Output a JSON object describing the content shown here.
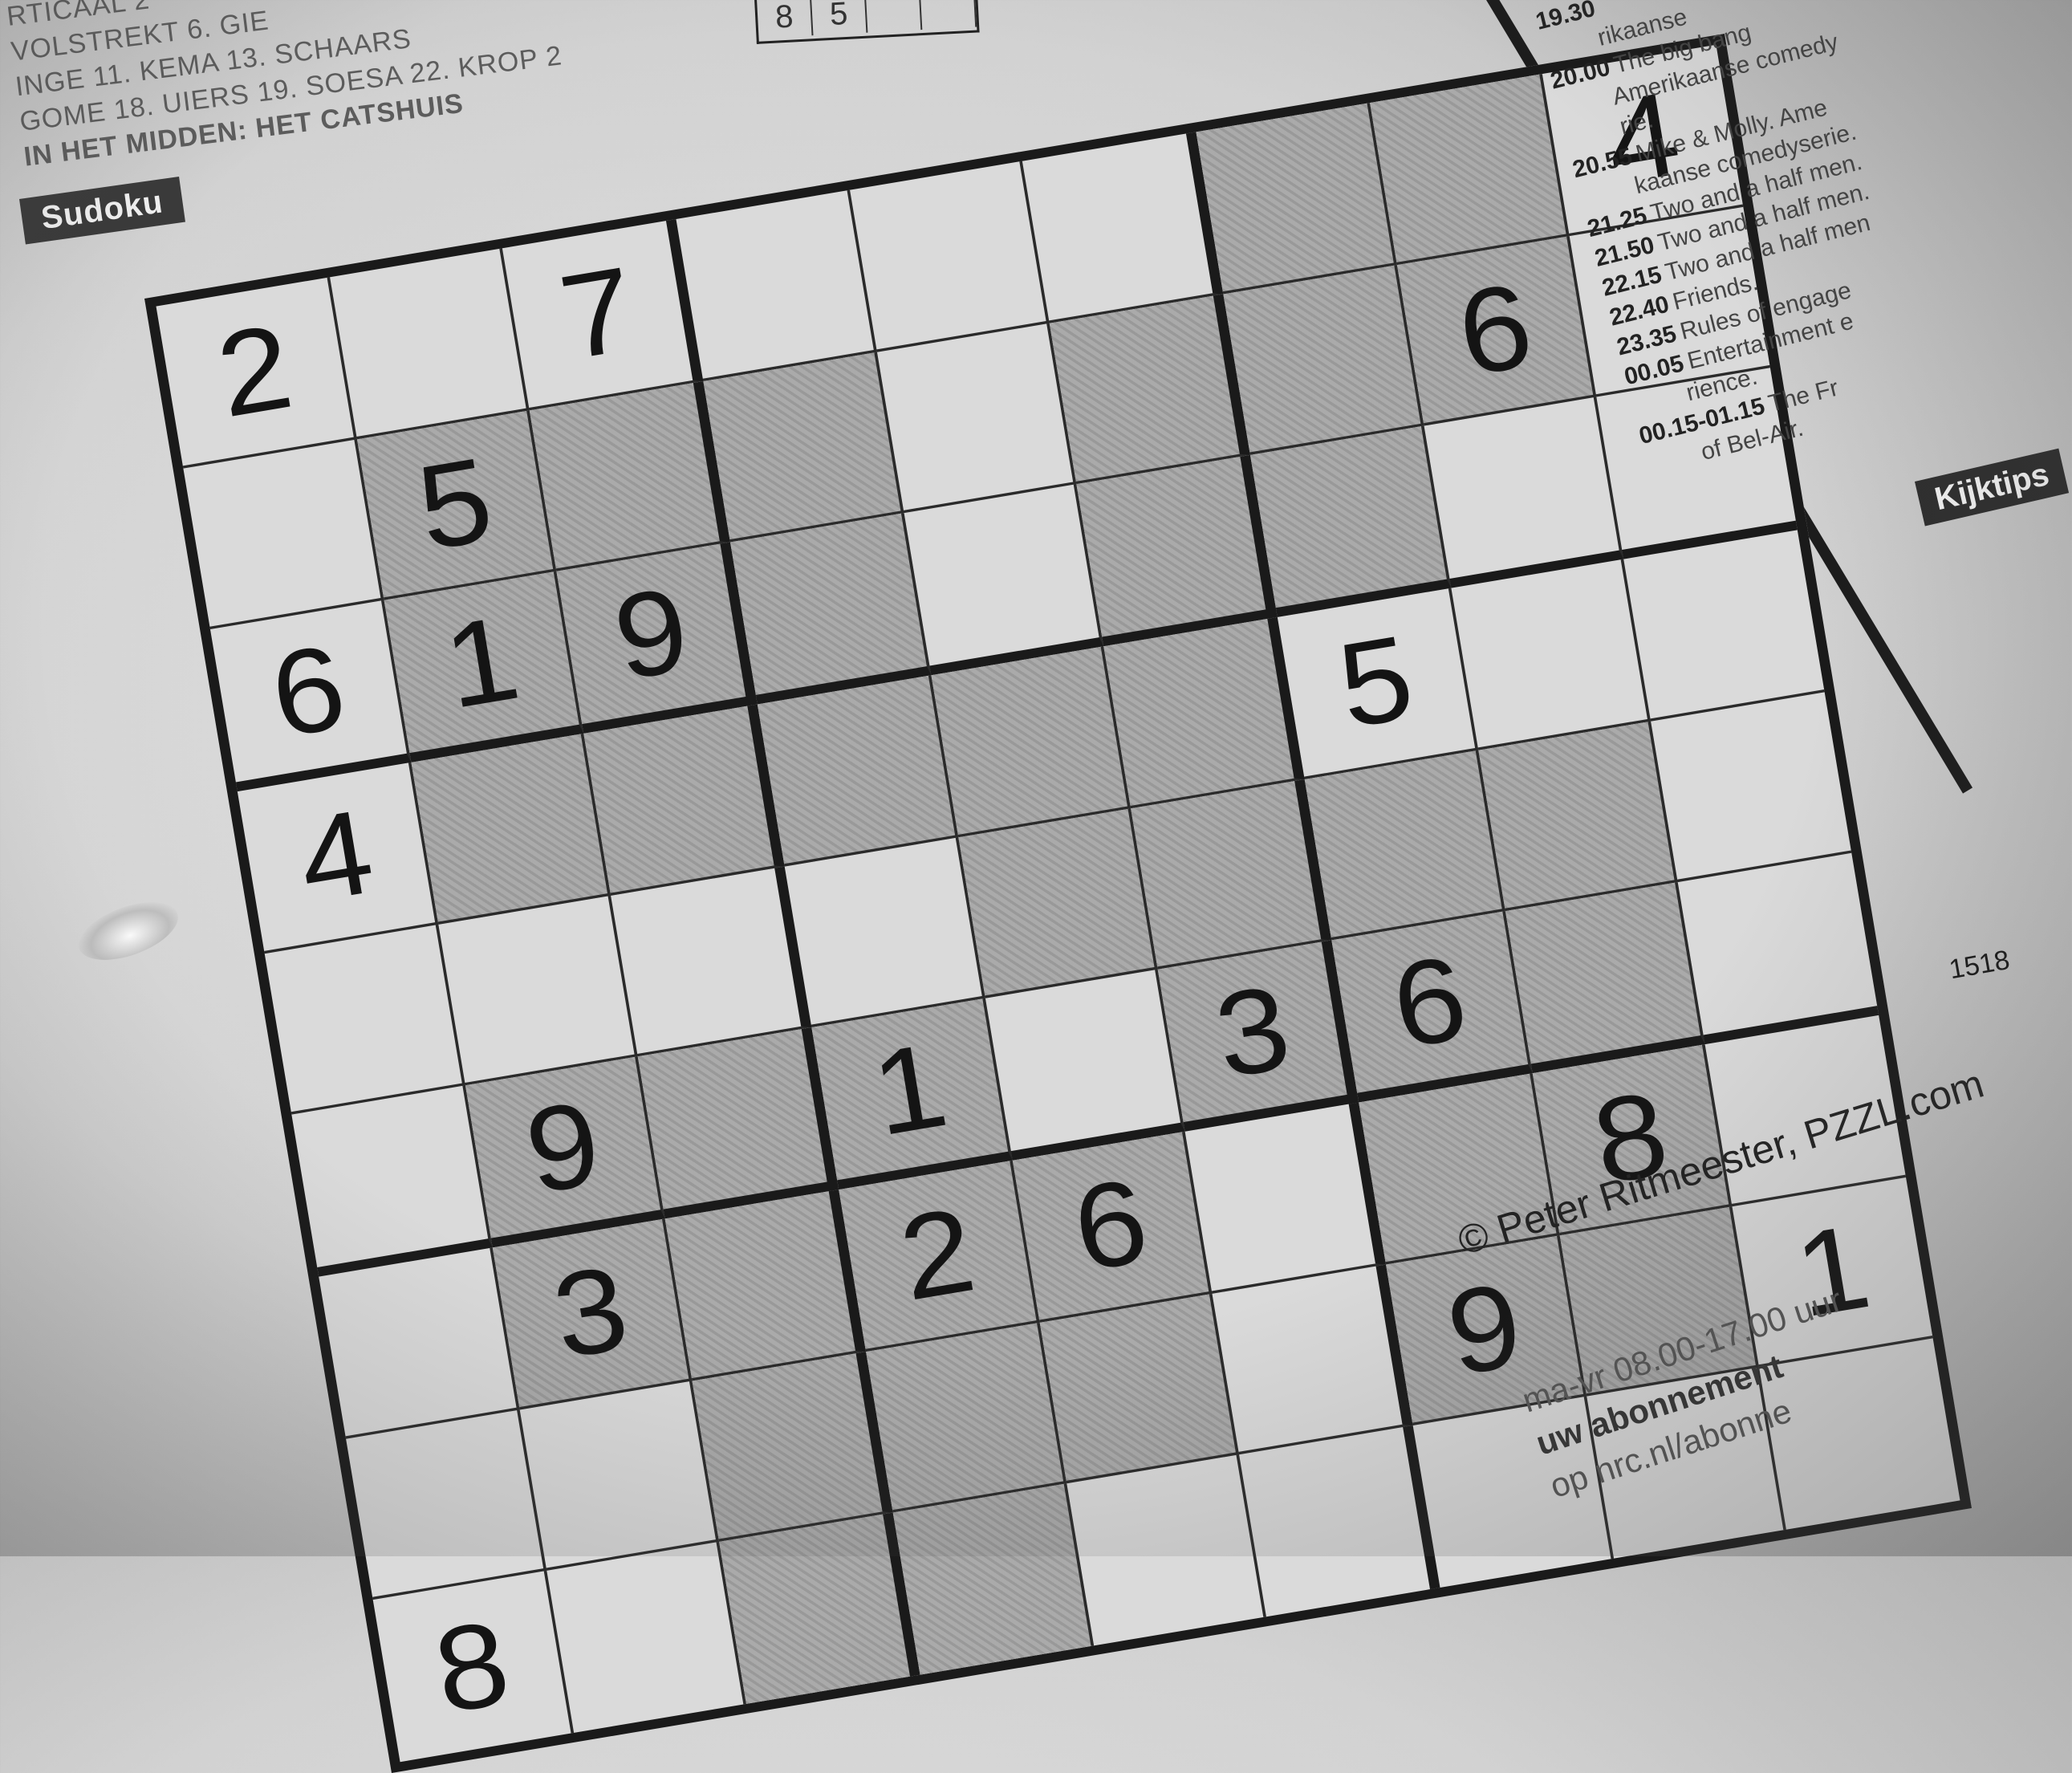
{
  "solutions": {
    "lines": [
      "RTICAAL 2",
      "VOLSTREKT 6. GIE",
      "INGE 11. KEMA 13. SCHAARS",
      "GOME 18. UIERS 19. SOESA 22. KROP 2",
      "IN HET MIDDEN: HET CATSHUIS"
    ]
  },
  "mini_grid": [
    "8",
    "5",
    "",
    ""
  ],
  "sudoku_label": "Sudoku",
  "puzzle": {
    "rows": [
      [
        "2",
        "",
        "7",
        "",
        "",
        "",
        "",
        "",
        "4"
      ],
      [
        "",
        "5",
        "",
        "",
        "",
        "",
        "",
        "6",
        ""
      ],
      [
        "6",
        "1",
        "9",
        "",
        "",
        "",
        "",
        "",
        ""
      ],
      [
        "4",
        "",
        "",
        "",
        "",
        "",
        "5",
        "",
        ""
      ],
      [
        "",
        "",
        "",
        "",
        "",
        "",
        "",
        "",
        ""
      ],
      [
        "",
        "9",
        "",
        "1",
        "",
        "3",
        "6",
        "",
        ""
      ],
      [
        "",
        "3",
        "",
        "2",
        "6",
        "",
        "",
        "8",
        ""
      ],
      [
        "",
        "",
        "",
        "",
        "",
        "",
        "9",
        "",
        "1"
      ],
      [
        "8",
        "",
        "",
        "",
        "",
        "",
        "",
        "",
        ""
      ]
    ],
    "shaded": [
      [
        0,
        0,
        0,
        0,
        0,
        0,
        1,
        1,
        0
      ],
      [
        0,
        1,
        1,
        1,
        0,
        1,
        1,
        1,
        0
      ],
      [
        0,
        1,
        1,
        1,
        0,
        1,
        1,
        0,
        0
      ],
      [
        0,
        1,
        1,
        1,
        1,
        1,
        0,
        0,
        0
      ],
      [
        0,
        0,
        0,
        0,
        1,
        1,
        1,
        1,
        0
      ],
      [
        0,
        1,
        1,
        1,
        0,
        1,
        1,
        1,
        0
      ],
      [
        0,
        1,
        1,
        1,
        1,
        0,
        1,
        1,
        0
      ],
      [
        0,
        0,
        1,
        1,
        1,
        0,
        1,
        1,
        0
      ],
      [
        0,
        0,
        1,
        1,
        0,
        0,
        0,
        0,
        0
      ]
    ],
    "number": "1518"
  },
  "copyright": "© Peter Ritmeester, PZZL.com",
  "tv_listings": [
    {
      "time": "19.30",
      "title": "",
      "sub": "rikaanse"
    },
    {
      "time": "20.00",
      "title": "The big bang",
      "sub": "Amerikaanse comedy"
    },
    {
      "time": "",
      "title": "",
      "sub": "rie."
    },
    {
      "time": "20.55",
      "title": "Mike & Molly. Ame",
      "sub": "kaanse comedyserie."
    },
    {
      "time": "21.25",
      "title": "Two and a half men.",
      "sub": ""
    },
    {
      "time": "21.50",
      "title": "Two and a half men.",
      "sub": ""
    },
    {
      "time": "22.15",
      "title": "Two and a half men",
      "sub": ""
    },
    {
      "time": "22.40",
      "title": "Friends.",
      "sub": ""
    },
    {
      "time": "23.35",
      "title": "Rules of engage",
      "sub": ""
    },
    {
      "time": "00.05",
      "title": "Entertainment e",
      "sub": "rience."
    },
    {
      "time": "00.15-01.15",
      "title": "The Fr",
      "sub": "of Bel-Air."
    }
  ],
  "kijktips": "Kijktips",
  "service": {
    "hours": "ma-vr 08.00-17.00 uur",
    "heading": "uw abonnement",
    "link": "op nrc.nl/abonne"
  },
  "colors": {
    "paper": "#d6d6d6",
    "ink": "#1a1a1a",
    "shade": "#a6a6a6"
  }
}
